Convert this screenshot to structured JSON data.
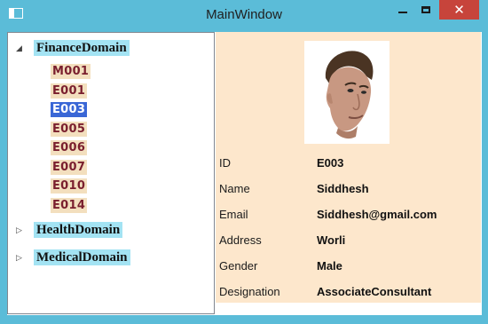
{
  "window": {
    "title": "MainWindow",
    "close_glyph": "✕"
  },
  "tree": {
    "expanded_glyph": "◢",
    "collapsed_glyph": "▷",
    "domains": [
      {
        "name": "FinanceDomain",
        "expanded": true,
        "employees": [
          "M001",
          "E001",
          "E003",
          "E005",
          "E006",
          "E007",
          "E010",
          "E014"
        ],
        "selected": "E003"
      },
      {
        "name": "HealthDomain",
        "expanded": false
      },
      {
        "name": "MedicalDomain",
        "expanded": false
      }
    ]
  },
  "details": {
    "fields": [
      {
        "label": "ID",
        "value": "E003"
      },
      {
        "label": "Name",
        "value": "Siddhesh"
      },
      {
        "label": "Email",
        "value": "Siddhesh@gmail.com"
      },
      {
        "label": "Address",
        "value": "Worli"
      },
      {
        "label": "Gender",
        "value": "Male"
      },
      {
        "label": "Designation",
        "value": "AssociateConsultant"
      }
    ]
  },
  "colors": {
    "window_frame": "#5bbcd8",
    "domain_label_bg": "#a3e3f3",
    "employee_label_bg": "#f3dfbe",
    "employee_text": "#7a1f2e",
    "selection": "#3a67d6",
    "details_bg": "#fde7cc",
    "close_button": "#c7443b"
  }
}
